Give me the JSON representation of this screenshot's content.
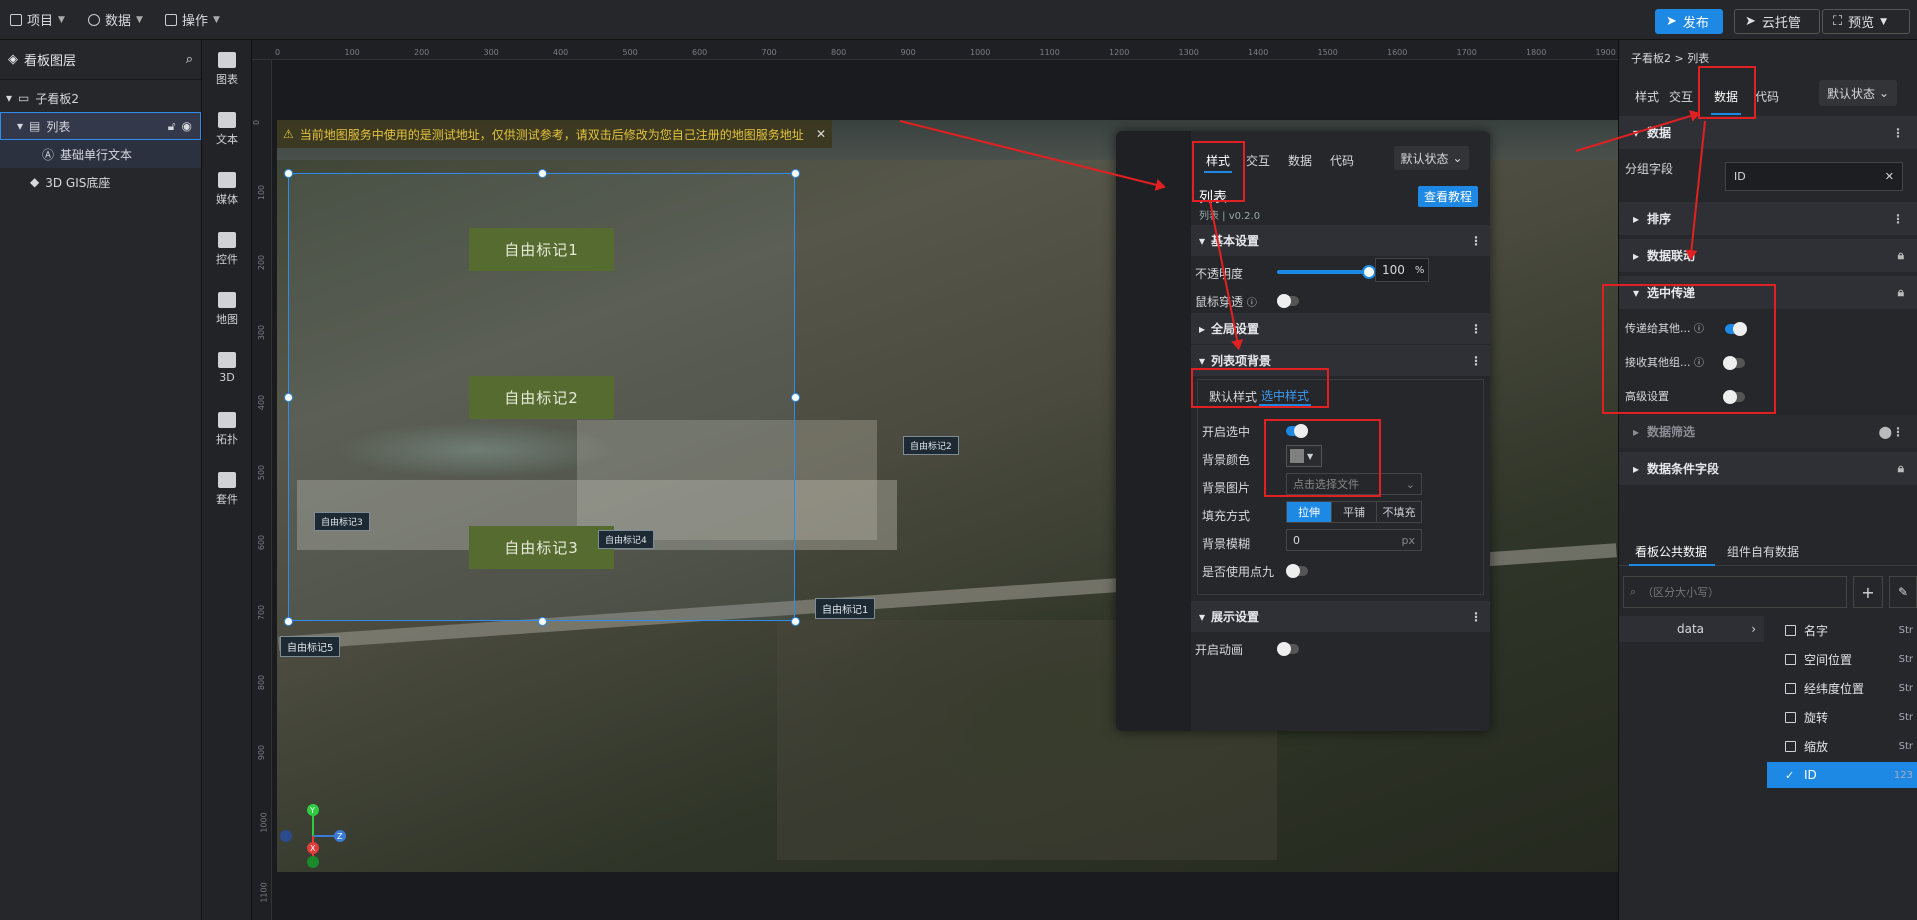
{
  "topbar": {
    "menus": [
      "项目",
      "数据",
      "操作"
    ],
    "publish": "发布",
    "cloud": "云托管",
    "preview": "预览"
  },
  "layers": {
    "title": "看板图层",
    "items": [
      "子看板2",
      "列表",
      "基础单行文本",
      "3D GIS底座"
    ]
  },
  "iconbar": [
    "图表",
    "文本",
    "媒体",
    "控件",
    "地图",
    "3D",
    "拓扑",
    "套件"
  ],
  "ruler": {
    "h": [
      "0",
      "100",
      "200",
      "300",
      "400",
      "500",
      "600",
      "700",
      "800",
      "900",
      "1000",
      "1100",
      "1200",
      "1300",
      "1400",
      "1500",
      "1600",
      "1700",
      "1800",
      "1900"
    ],
    "v": [
      "0",
      "100",
      "200",
      "300",
      "400",
      "500",
      "600",
      "700",
      "800",
      "900",
      "1000",
      "1100"
    ]
  },
  "canvas": {
    "warning": "当前地图服务中使用的是测试地址，仅供测试参考，请双击后修改为您自己注册的地图服务地址",
    "marks": [
      "自由标记1",
      "自由标记2",
      "自由标记3"
    ],
    "pins": [
      "自由标记3",
      "自由标记4",
      "自由标记2",
      "自由标记1",
      "自由标记5"
    ],
    "axes": [
      "Y",
      "Z",
      "X"
    ]
  },
  "float_panel": {
    "tabs": [
      "样式",
      "交互",
      "数据",
      "代码"
    ],
    "state": "默认状态",
    "title": "列表",
    "tutorial": "查看教程",
    "version": "列表 | v0.2.0",
    "basic": "基本设置",
    "opacity_label": "不透明度",
    "opacity_value": "100",
    "opacity_unit": "%",
    "opacity_fill": 1.0,
    "mouse_through": "鼠标穿透",
    "global": "全局设置",
    "bg_section": "列表项背景",
    "subtabs": [
      "默认样式",
      "选中样式"
    ],
    "open_selected": "开启选中",
    "bg_color": "背景颜色",
    "bg_image": "背景图片",
    "bg_image_ph": "点击选择文件",
    "fill_mode": "填充方式",
    "fill_opts": [
      "拉伸",
      "平铺",
      "不填充"
    ],
    "blur": "背景模糊",
    "blur_value": "0",
    "blur_unit": "px",
    "nine": "是否使用点九",
    "display": "展示设置",
    "animation": "开启动画"
  },
  "right": {
    "breadcrumb": "子看板2 > 列表",
    "tabs": [
      "样式",
      "交互",
      "数据",
      "代码"
    ],
    "state": "默认状态",
    "data_section": "数据",
    "group_field_label": "分组字段",
    "group_field_value": "ID",
    "sort": "排序",
    "linkage": "数据联动",
    "pass": "选中传递",
    "pass_rows": [
      "传递给其他...",
      "接收其他组...",
      "高级设置"
    ],
    "filter": "数据筛选",
    "cond_fields": "数据条件字段",
    "data_tabs": [
      "看板公共数据",
      "组件自有数据"
    ],
    "search_ph": "（区分大小写）",
    "tree_node": "data",
    "fields": [
      {
        "name": "名字",
        "type": "Str"
      },
      {
        "name": "空间位置",
        "type": "Str"
      },
      {
        "name": "经纬度位置",
        "type": "Str"
      },
      {
        "name": "旋转",
        "type": "Str"
      },
      {
        "name": "缩放",
        "type": "Str"
      },
      {
        "name": "ID",
        "type": "123"
      }
    ]
  },
  "colors": {
    "accent": "#1e88e5",
    "highlight": "#e12121",
    "mark": "#556b2f"
  }
}
